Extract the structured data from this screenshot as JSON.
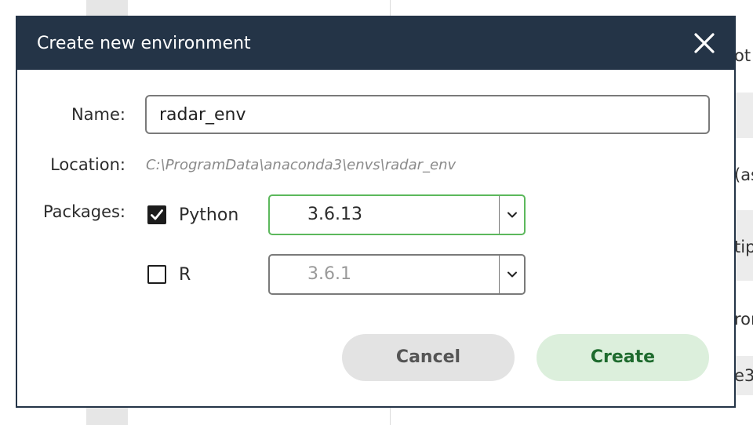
{
  "background": {
    "row_fragments": [
      "ot",
      "(as",
      "tip",
      "ror",
      "e3"
    ]
  },
  "dialog": {
    "title": "Create new environment",
    "close_icon": "close-icon",
    "name": {
      "label": "Name:",
      "value": "radar_env"
    },
    "location": {
      "label": "Location:",
      "value": "C:\\ProgramData\\anaconda3\\envs\\radar_env"
    },
    "packages": {
      "label": "Packages:",
      "items": [
        {
          "name": "Python",
          "checked": true,
          "version": "3.6.13",
          "enabled": true
        },
        {
          "name": "R",
          "checked": false,
          "version": "3.6.1",
          "enabled": false
        }
      ]
    },
    "buttons": {
      "cancel": "Cancel",
      "create": "Create"
    }
  },
  "colors": {
    "header_bg": "#243447",
    "accent_green": "#5cb85c",
    "create_text": "#1e6b2e",
    "create_bg": "#dcefdc",
    "cancel_bg": "#e3e3e3"
  }
}
